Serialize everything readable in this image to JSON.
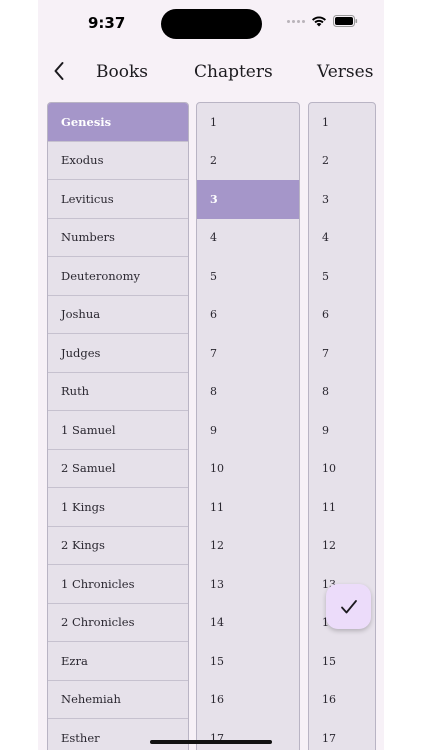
{
  "status_bar": {
    "time": "9:37"
  },
  "header": {
    "back_icon": "chevron-left-icon",
    "books_label": "Books",
    "chapters_label": "Chapters",
    "verses_label": "Verses"
  },
  "books": {
    "selected": "Genesis",
    "items": [
      "Genesis",
      "Exodus",
      "Leviticus",
      "Numbers",
      "Deuteronomy",
      "Joshua",
      "Judges",
      "Ruth",
      "1 Samuel",
      "2 Samuel",
      "1 Kings",
      "2 Kings",
      "1 Chronicles",
      "2 Chronicles",
      "Ezra",
      "Nehemiah",
      "Esther"
    ]
  },
  "chapters": {
    "selected": "3",
    "items": [
      "1",
      "2",
      "3",
      "4",
      "5",
      "6",
      "7",
      "8",
      "9",
      "10",
      "11",
      "12",
      "13",
      "14",
      "15",
      "16",
      "17"
    ]
  },
  "verses": {
    "selected": "",
    "items": [
      "1",
      "2",
      "3",
      "4",
      "5",
      "6",
      "7",
      "8",
      "9",
      "10",
      "11",
      "12",
      "13",
      "14",
      "15",
      "16",
      "17"
    ]
  },
  "fab": {
    "icon": "checkmark-icon"
  },
  "colors": {
    "background": "#f7f1f7",
    "list_bg": "#e6e1ea",
    "selected": "#a596c9",
    "fab": "#ecdcfa"
  }
}
